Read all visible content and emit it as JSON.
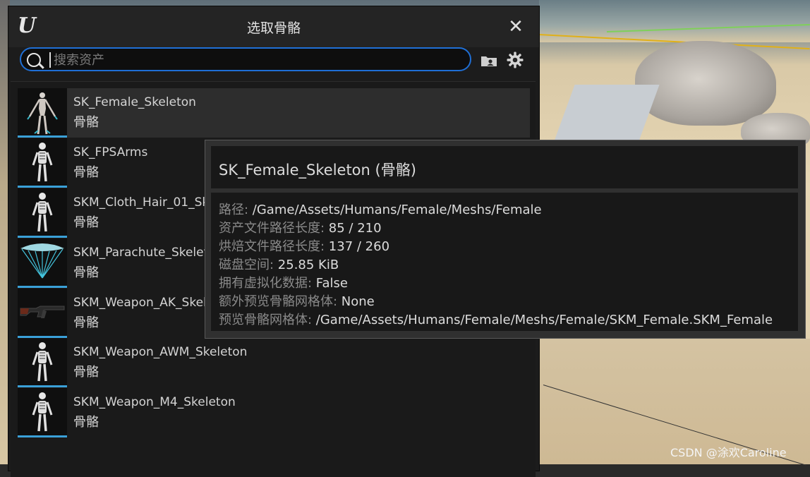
{
  "dialog": {
    "title": "选取骨骼",
    "search_placeholder": "搜索资产"
  },
  "assets": [
    {
      "name": "SK_Female_Skeleton",
      "type": "骨骼"
    },
    {
      "name": "SK_FPSArms",
      "type": "骨骼"
    },
    {
      "name": "SKM_Cloth_Hair_01_Sk",
      "type": "骨骼"
    },
    {
      "name": "SKM_Parachute_Skelet",
      "type": "骨骼"
    },
    {
      "name": "SKM_Weapon_AK_Skele",
      "type": "骨骼"
    },
    {
      "name": "SKM_Weapon_AWM_Skeleton",
      "type": "骨骼"
    },
    {
      "name": "SKM_Weapon_M4_Skeleton",
      "type": "骨骼"
    }
  ],
  "tooltip": {
    "title": "SK_Female_Skeleton (骨骼)",
    "rows": [
      {
        "key": "路径: ",
        "value": "/Game/Assets/Humans/Female/Meshs/Female"
      },
      {
        "key": "资产文件路径长度: ",
        "value": "85 / 210"
      },
      {
        "key": "烘焙文件路径长度: ",
        "value": "137 / 260"
      },
      {
        "key": "磁盘空间: ",
        "value": "25.85 KiB"
      },
      {
        "key": "拥有虚拟化数据: ",
        "value": "False"
      },
      {
        "key": "额外预览骨骼网格体: ",
        "value": "None"
      },
      {
        "key": "预览骨骼网格体: ",
        "value": "/Game/Assets/Humans/Female/Meshs/Female/SKM_Female.SKM_Female"
      }
    ]
  },
  "watermark": "CSDN @涂欢Caroline",
  "colors": {
    "accent": "#1f6fd6",
    "thumb_underline": "#3aa0d8"
  }
}
